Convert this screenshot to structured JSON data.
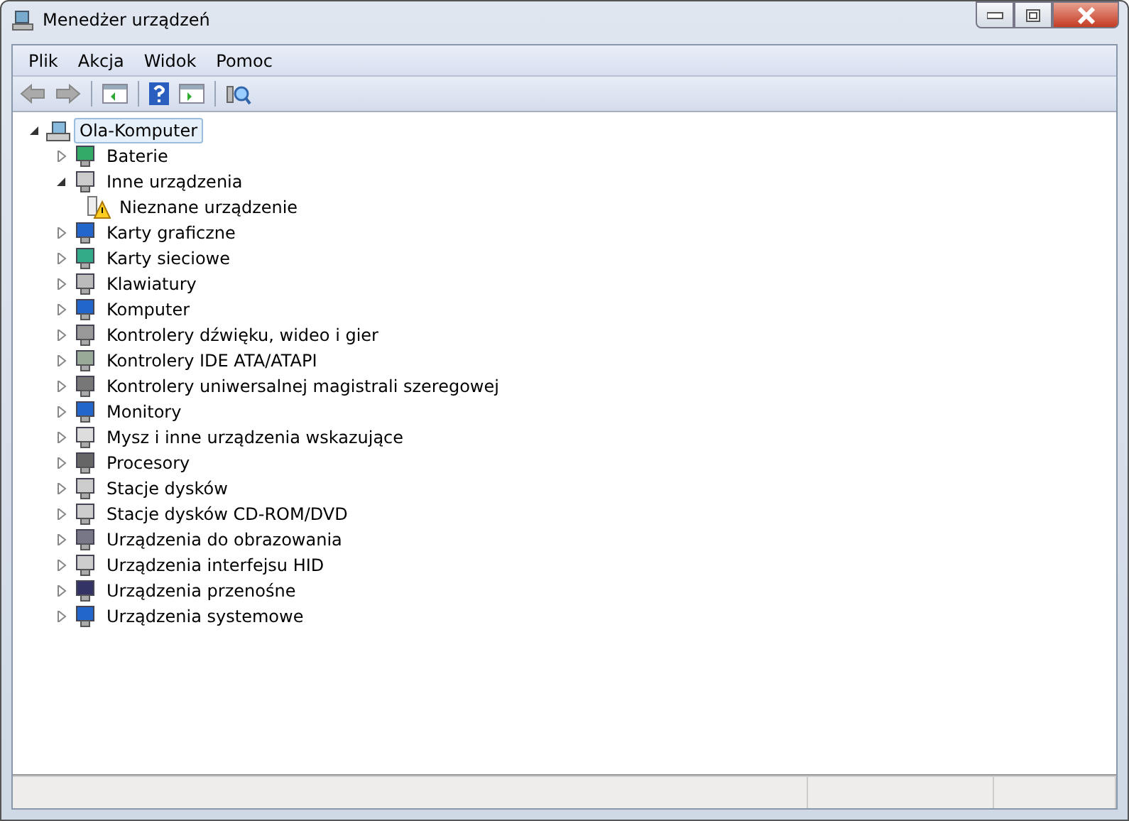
{
  "window": {
    "title": "Menedżer urządzeń"
  },
  "menu": [
    "Plik",
    "Akcja",
    "Widok",
    "Pomoc"
  ],
  "tree": {
    "label": "Ola-Komputer",
    "selected": true,
    "expanded": true,
    "children": [
      {
        "label": "Baterie",
        "expanded": false
      },
      {
        "label": "Inne urządzenia",
        "expanded": true,
        "children": [
          {
            "label": "Nieznane urządzenie",
            "warning": true
          }
        ]
      },
      {
        "label": "Karty graficzne",
        "expanded": false
      },
      {
        "label": "Karty sieciowe",
        "expanded": false
      },
      {
        "label": "Klawiatury",
        "expanded": false
      },
      {
        "label": "Komputer",
        "expanded": false
      },
      {
        "label": "Kontrolery dźwięku, wideo i gier",
        "expanded": false
      },
      {
        "label": "Kontrolery IDE ATA/ATAPI",
        "expanded": false
      },
      {
        "label": "Kontrolery uniwersalnej magistrali szeregowej",
        "expanded": false
      },
      {
        "label": "Monitory",
        "expanded": false
      },
      {
        "label": "Mysz i inne urządzenia wskazujące",
        "expanded": false
      },
      {
        "label": "Procesory",
        "expanded": false
      },
      {
        "label": "Stacje dysków",
        "expanded": false
      },
      {
        "label": "Stacje dysków CD-ROM/DVD",
        "expanded": false
      },
      {
        "label": "Urządzenia do obrazowania",
        "expanded": false
      },
      {
        "label": "Urządzenia interfejsu HID",
        "expanded": false
      },
      {
        "label": "Urządzenia przenośne",
        "expanded": false
      },
      {
        "label": "Urządzenia systemowe",
        "expanded": false
      }
    ]
  }
}
